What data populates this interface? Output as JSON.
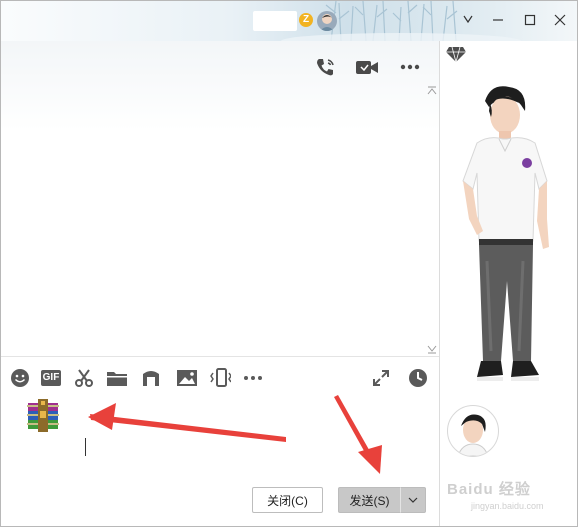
{
  "window": {
    "title_badge": "Z",
    "controls": [
      "chevron-down-icon",
      "minimize-icon",
      "maximize-icon",
      "close-icon"
    ]
  },
  "header_actions": [
    "phone-icon",
    "video-call-icon",
    "more-icon"
  ],
  "toolbar": {
    "gif_label": "GIF",
    "items": [
      "emoji-icon",
      "gif-icon",
      "scissors-icon",
      "folder-icon",
      "music-icon",
      "image-icon",
      "shake-icon",
      "more-icon",
      "expand-icon",
      "history-clock-icon"
    ]
  },
  "input": {
    "attachment": "winrar-archive-icon",
    "value": ""
  },
  "buttons": {
    "close_label": "关闭(C)",
    "send_label": "发送(S)"
  },
  "watermark": {
    "text": "Baidu 经验",
    "sub": "jingyan.baidu.com"
  },
  "colors": {
    "arrow": "#e8413b",
    "send_bg": "#c8c8c8",
    "z_badge": "#f2b321"
  }
}
